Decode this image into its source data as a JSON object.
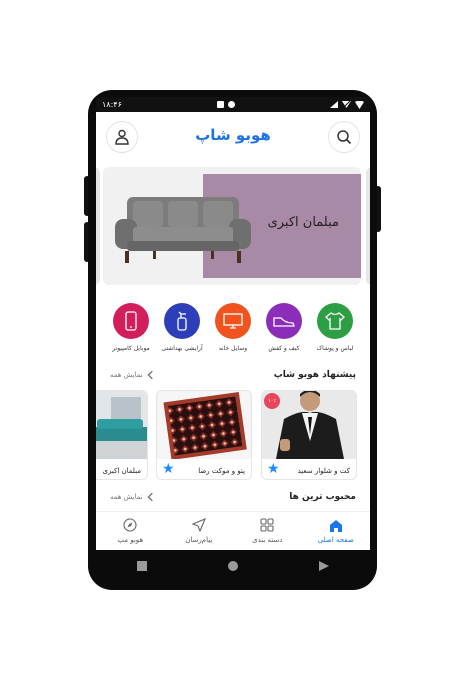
{
  "status": {
    "time": "۱۸:۴۶"
  },
  "header": {
    "brand": "هوبو شاپ"
  },
  "banner": {
    "title": "مبلمان اکبری",
    "colors": {
      "panel": "#a98aa6"
    }
  },
  "categories": [
    {
      "label": "لباس و پوشاک",
      "color": "#2e9e44",
      "icon": "shirt-icon"
    },
    {
      "label": "کیف و کفش",
      "color": "#8b2db8",
      "icon": "shoe-icon"
    },
    {
      "label": "وسایل خانه",
      "color": "#f0531e",
      "icon": "tv-icon"
    },
    {
      "label": "آرایشی بهداشتی",
      "color": "#2d3fb8",
      "icon": "bottle-icon"
    },
    {
      "label": "موبایل کامپیوتر",
      "color": "#d21f5c",
      "icon": "phone-icon"
    }
  ],
  "suggest": {
    "title": "پیشنهاد هوبو شاپ",
    "see_all": "نمایش همه",
    "items": [
      {
        "name": "کت و شلوار سعید",
        "badge": "۱۰٪"
      },
      {
        "name": "پتو و موکت رضا"
      },
      {
        "name": "مبلمان اکبری"
      }
    ]
  },
  "popular": {
    "title": "محبوب ترین ها",
    "see_all": "نمایش همه"
  },
  "bottom_nav": [
    {
      "label": "صفحه اصلی",
      "active": true
    },
    {
      "label": "دسته بندی"
    },
    {
      "label": "پیام‌رسان"
    },
    {
      "label": "هوبو مپ"
    }
  ],
  "colors": {
    "accent": "#1a73e8",
    "star": "#1a8cff"
  }
}
